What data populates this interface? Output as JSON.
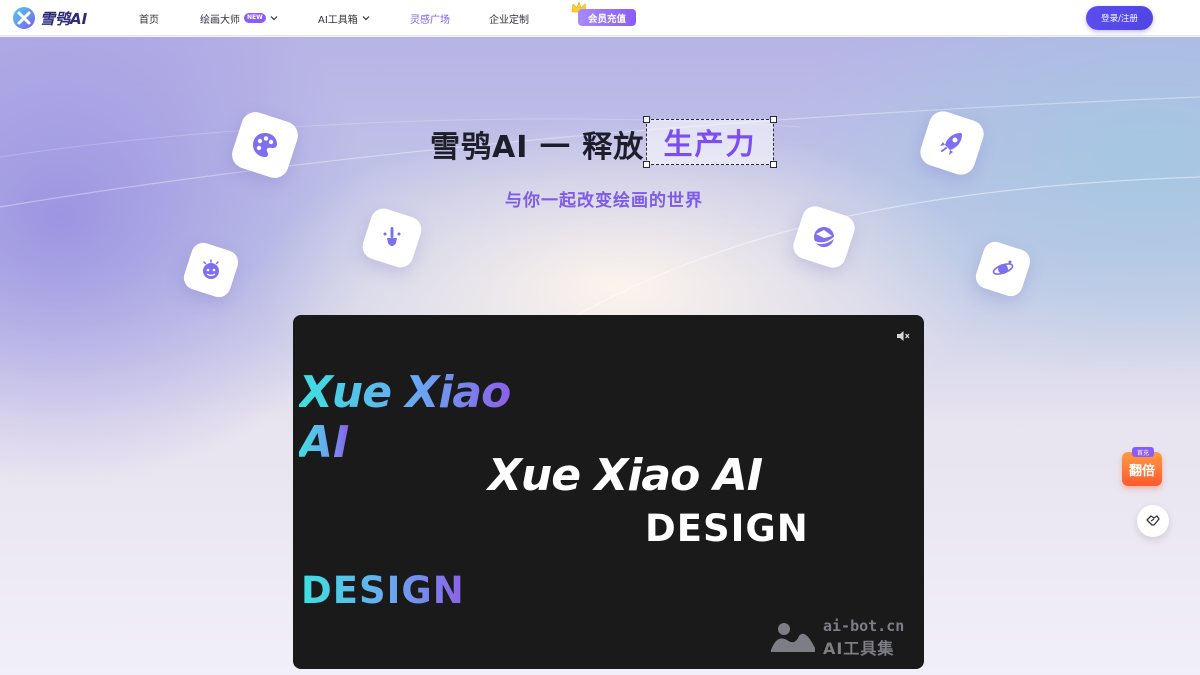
{
  "brand": {
    "name": "雪鸮AI",
    "accent": "#7b5cf0",
    "primary_button": "#5046e5"
  },
  "nav": {
    "home": "首页",
    "painter": "绘画大师",
    "painter_badge": "NEW",
    "toolbox": "AI工具箱",
    "inspiration": "灵感广场",
    "enterprise": "企业定制",
    "vip": "会员充值",
    "login": "登录/注册"
  },
  "hero": {
    "headline": "雪鸮AI 一 释放",
    "highlight": "生产力",
    "subtitle": "与你一起改变绘画的世界",
    "floating_icons": [
      "palette-icon",
      "brush-icon",
      "face-icon",
      "rocket-icon",
      "planet-icon",
      "satellite-icon"
    ]
  },
  "video": {
    "muted": true,
    "line1": "Xue Xiao",
    "line2": "AI",
    "line3": "Xue Xiao AI",
    "line4": "DESIGN",
    "line5": "DESIGN",
    "watermark_url": "ai-bot.cn",
    "watermark_name": "AI工具集"
  },
  "side": {
    "promo_tag": "首充",
    "promo_text": "翻倍"
  }
}
